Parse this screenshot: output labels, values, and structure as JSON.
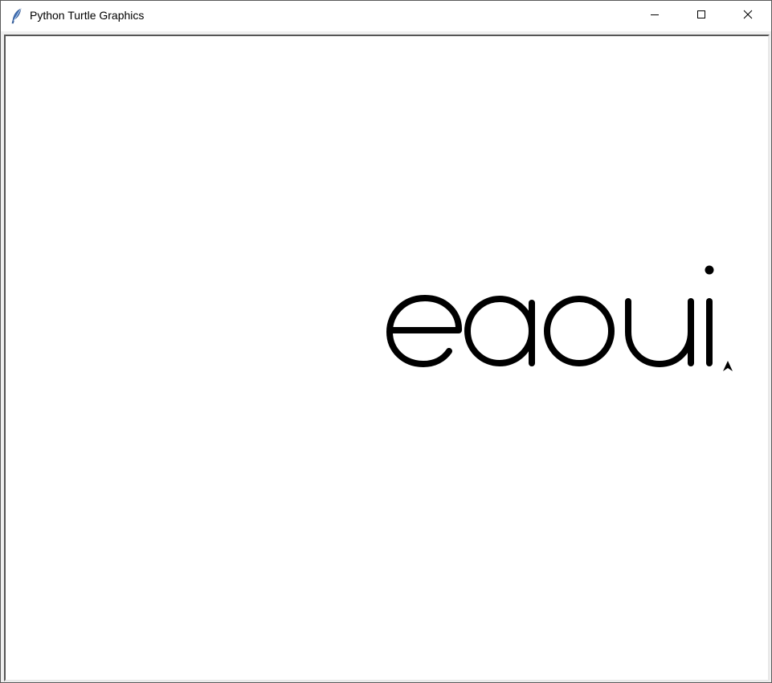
{
  "window": {
    "title": "Python Turtle Graphics",
    "app_icon": "feather-icon",
    "buttons": {
      "minimize": "minimize-icon",
      "maximize": "maximize-icon",
      "close": "close-icon"
    }
  },
  "canvas": {
    "background": "#ffffff",
    "drawing": {
      "text": "eaoui",
      "stroke_color": "#000000"
    },
    "turtle": {
      "shape": "classic-arrow",
      "heading": "up",
      "color": "#000000"
    }
  }
}
